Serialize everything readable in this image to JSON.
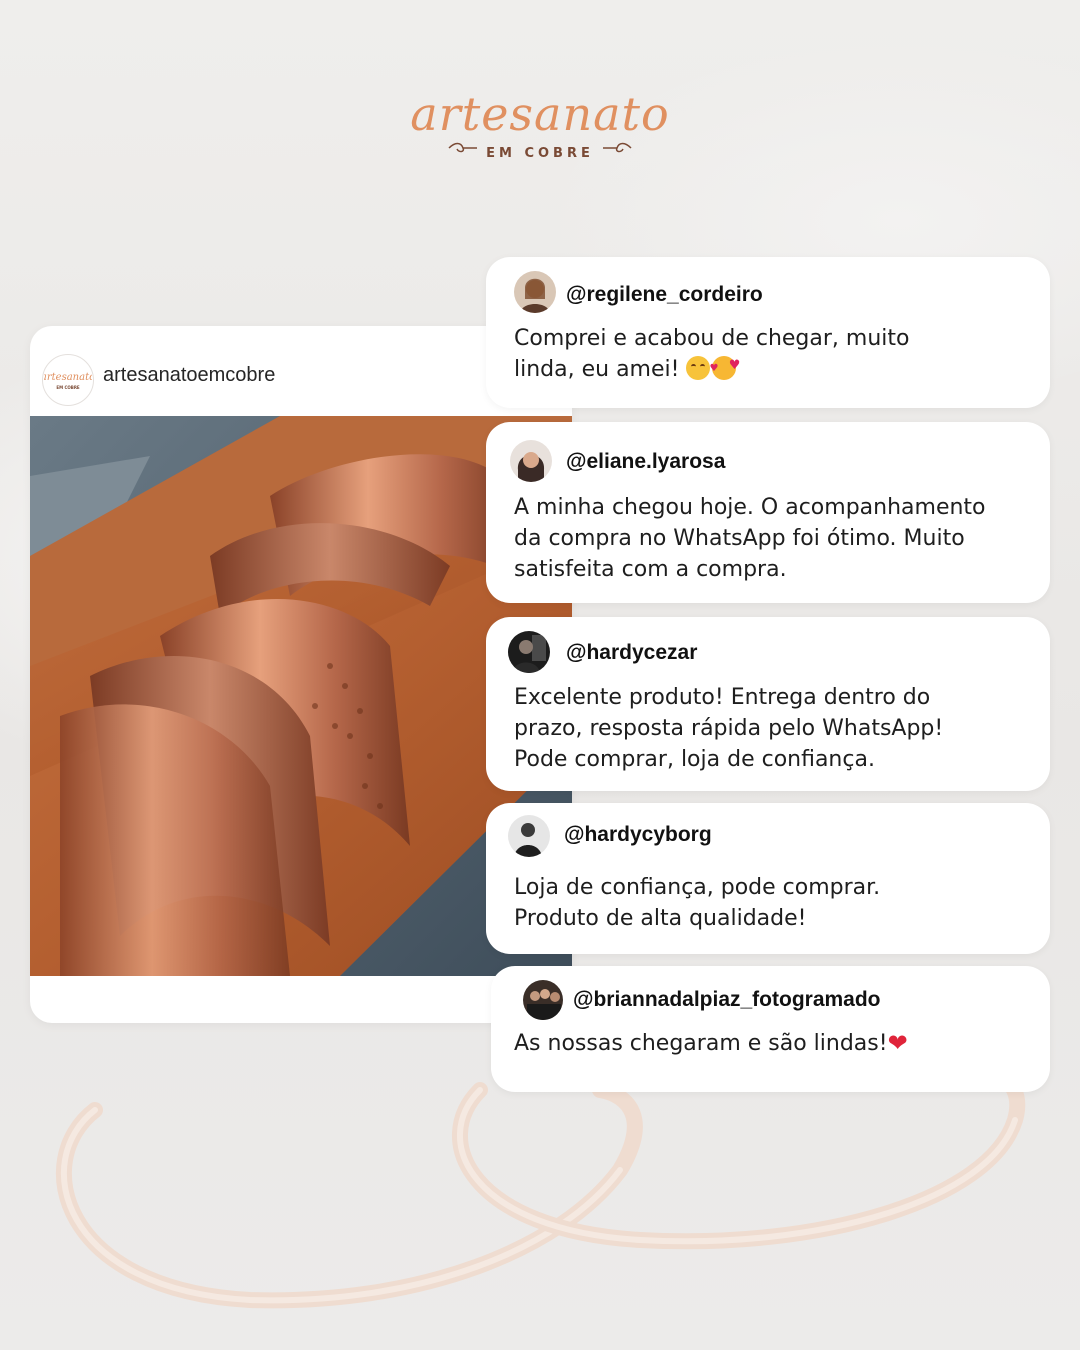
{
  "logo": {
    "script": "artesanato",
    "subtitle": "EM COBRE"
  },
  "post": {
    "username": "artesanatoemcobre",
    "avatar_text": "artesanato",
    "avatar_sub": "EM COBRE"
  },
  "comments": [
    {
      "username": "@regilene_cordeiro",
      "text": "Comprei e acabou de chegar, muito\nlinda, eu amei! ",
      "emojis": [
        "smiling-face-icon",
        "smiling-face-with-hearts-icon"
      ]
    },
    {
      "username": "@eliane.lyarosa",
      "text": "A minha chegou hoje. O acompanhamento\nda compra no WhatsApp foi ótimo. Muito\nsatisfeita com a compra."
    },
    {
      "username": "@hardycezar",
      "text": "Excelente produto! Entrega dentro do\nprazo, resposta rápida pelo WhatsApp!\nPode comprar, loja de confiança."
    },
    {
      "username": "@hardycyborg",
      "text": "Loja de confiança, pode comprar.\nProduto de alta qualidade!"
    },
    {
      "username": "@briannadalpiaz_fotogramado",
      "text": "As nossas chegaram e são lindas!",
      "emoji_text": "❤"
    }
  ],
  "colors": {
    "brand_orange": "#e09060",
    "brand_brown": "#7a4a35",
    "card_bg": "#ffffff",
    "page_bg": "#ebe9e7"
  }
}
